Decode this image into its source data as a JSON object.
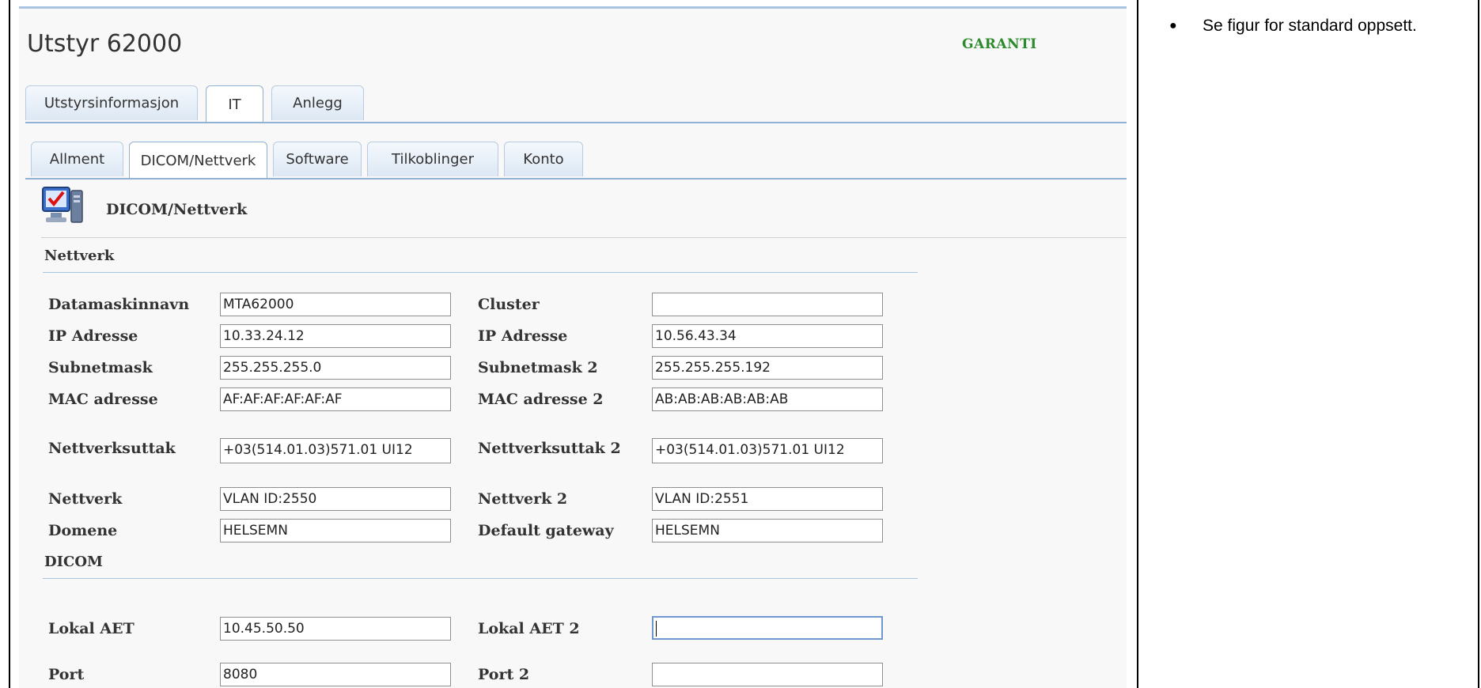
{
  "window": {
    "title": "Utstyr 62000",
    "status": "GARANTI"
  },
  "main_tabs": [
    "Utstyrsinformasjon",
    "IT",
    "Anlegg"
  ],
  "sub_tabs": [
    "Allment",
    "DICOM/Nettverk",
    "Software",
    "Tilkoblinger",
    "Konto"
  ],
  "section": {
    "heading": "DICOM/Nettverk",
    "icon": "computer-check-icon"
  },
  "groups": {
    "network": "Nettverk",
    "dicom": "DICOM"
  },
  "fields": {
    "datamaskinnavn": {
      "label": "Datamaskinnavn",
      "value": "MTA62000"
    },
    "cluster": {
      "label": "Cluster",
      "value": ""
    },
    "ip1": {
      "label": "IP Adresse",
      "value": "10.33.24.12"
    },
    "ip2": {
      "label": "IP Adresse",
      "value": "10.56.43.34"
    },
    "subnet1": {
      "label": "Subnetmask",
      "value": "255.255.255.0"
    },
    "subnet2": {
      "label": "Subnetmask 2",
      "value": "255.255.255.192"
    },
    "mac1": {
      "label": "MAC adresse",
      "value": "AF:AF:AF:AF:AF:AF"
    },
    "mac2": {
      "label": "MAC adresse 2",
      "value": "AB:AB:AB:AB:AB:AB"
    },
    "uttak1": {
      "label": "Nettverksuttak",
      "value": "+03(514.01.03)571.01 UI12"
    },
    "uttak2": {
      "label": "Nettverksuttak 2",
      "value": "+03(514.01.03)571.01 UI12"
    },
    "nett1": {
      "label": "Nettverk",
      "value": "VLAN ID:2550"
    },
    "nett2": {
      "label": "Nettverk 2",
      "value": "VLAN ID:2551"
    },
    "domene": {
      "label": "Domene",
      "value": "HELSEMN"
    },
    "gateway": {
      "label": "Default gateway",
      "value": "HELSEMN"
    },
    "aet1": {
      "label": "Lokal AET",
      "value": "10.45.50.50"
    },
    "aet2": {
      "label": "Lokal AET 2",
      "value": ""
    },
    "port1": {
      "label": "Port",
      "value": "8080"
    },
    "port2": {
      "label": "Port 2",
      "value": ""
    }
  },
  "side_note": {
    "text": "Se figur for standard oppsett."
  }
}
